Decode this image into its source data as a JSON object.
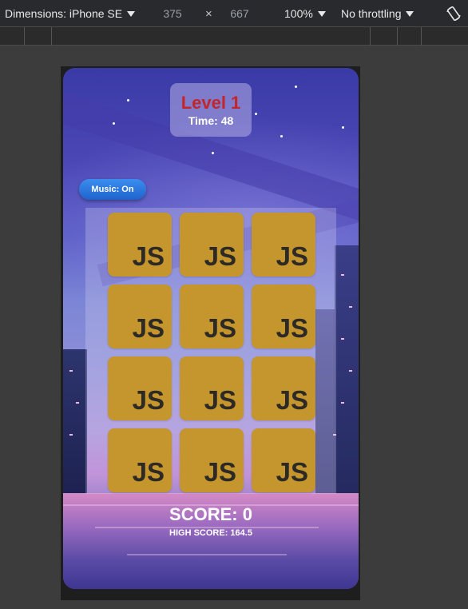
{
  "devtools": {
    "device_label": "Dimensions: iPhone SE",
    "width": "375",
    "times": "×",
    "height": "667",
    "zoom": "100%",
    "throttling": "No throttling",
    "rotate_icon": "rotate-icon"
  },
  "game": {
    "level_title": "Level 1",
    "time_text": "Time: 48",
    "music_button": "Music: On",
    "card_label": "JS",
    "cards": [
      "JS",
      "JS",
      "JS",
      "JS",
      "JS",
      "JS",
      "JS",
      "JS",
      "JS",
      "JS",
      "JS",
      "JS"
    ],
    "score_text": "SCORE: 0",
    "high_score_text": "HIGH SCORE: 164.5"
  },
  "colors": {
    "level_title": "#c0262c",
    "card": "#c5962d",
    "music_button": "#2a78e4"
  }
}
